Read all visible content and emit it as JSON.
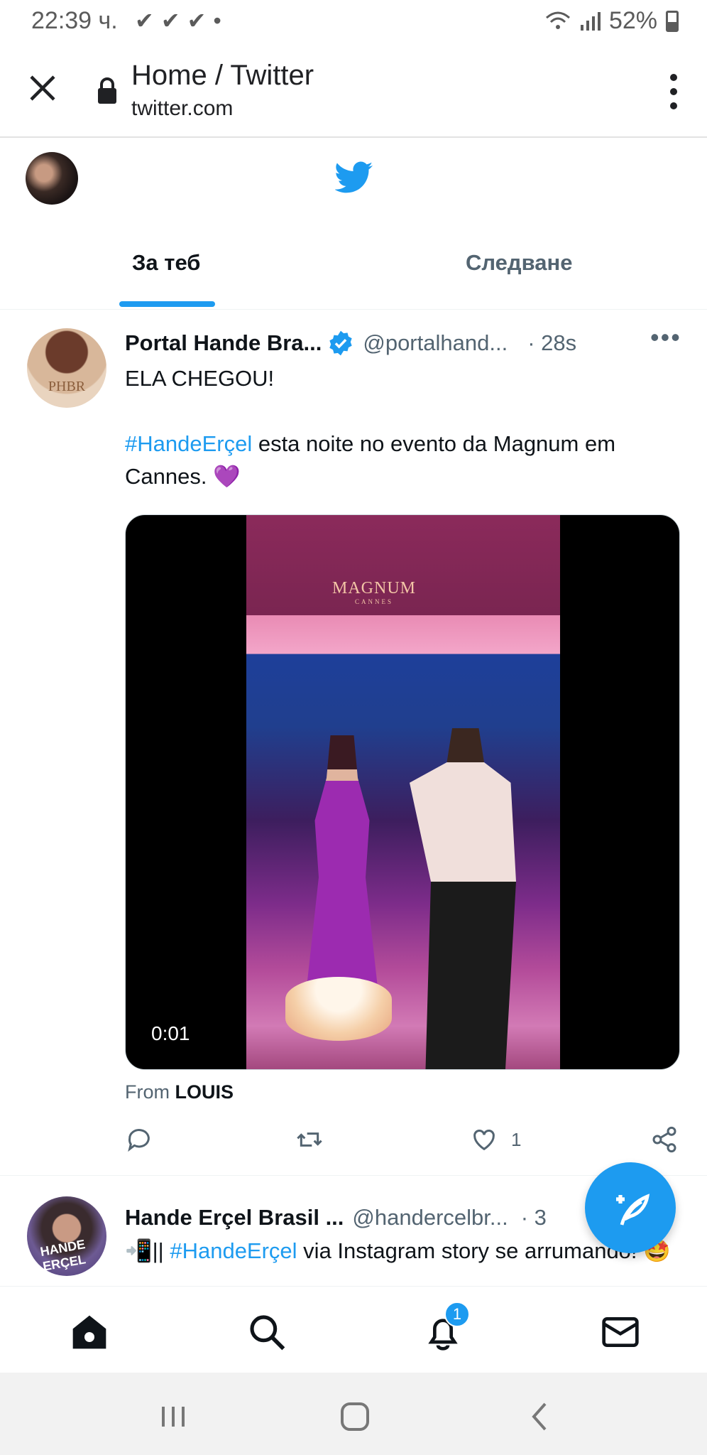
{
  "status_bar": {
    "time": "22:39 ч.",
    "battery": "52%"
  },
  "browser": {
    "title": "Home / Twitter",
    "url": "twitter.com"
  },
  "tabs": [
    {
      "label": "За теб"
    },
    {
      "label": "Следване"
    }
  ],
  "tweets": [
    {
      "name": "Portal Hande Bra...",
      "handle": "@portalhand...",
      "time": "· 28s",
      "avatar_text": "PHBR",
      "line1": "ELA CHEGOU!",
      "hashtag": "#HandeErçel",
      "line2_rest": " esta noite no evento da Magnum em Cannes. 💜",
      "video": {
        "sign": "MAGNUM",
        "sign_sub": "CANNES",
        "time": "0:01"
      },
      "attribution_prefix": "From",
      "attribution_name": "LOUIS",
      "likes": "1"
    },
    {
      "name": "Hande Erçel Brasil ...",
      "handle": "@handercelbr...",
      "time": "· 3",
      "avatar_text": "HANDE ERÇEL",
      "text_prefix": "📲||",
      "hashtag": "#HandeErçel",
      "text_rest": " via Instagram story se arrumando! 🤩"
    }
  ],
  "notifications_badge": "1",
  "colors": {
    "accent": "#1d9bf0",
    "text": "#0f1419",
    "secondary": "#536471"
  }
}
